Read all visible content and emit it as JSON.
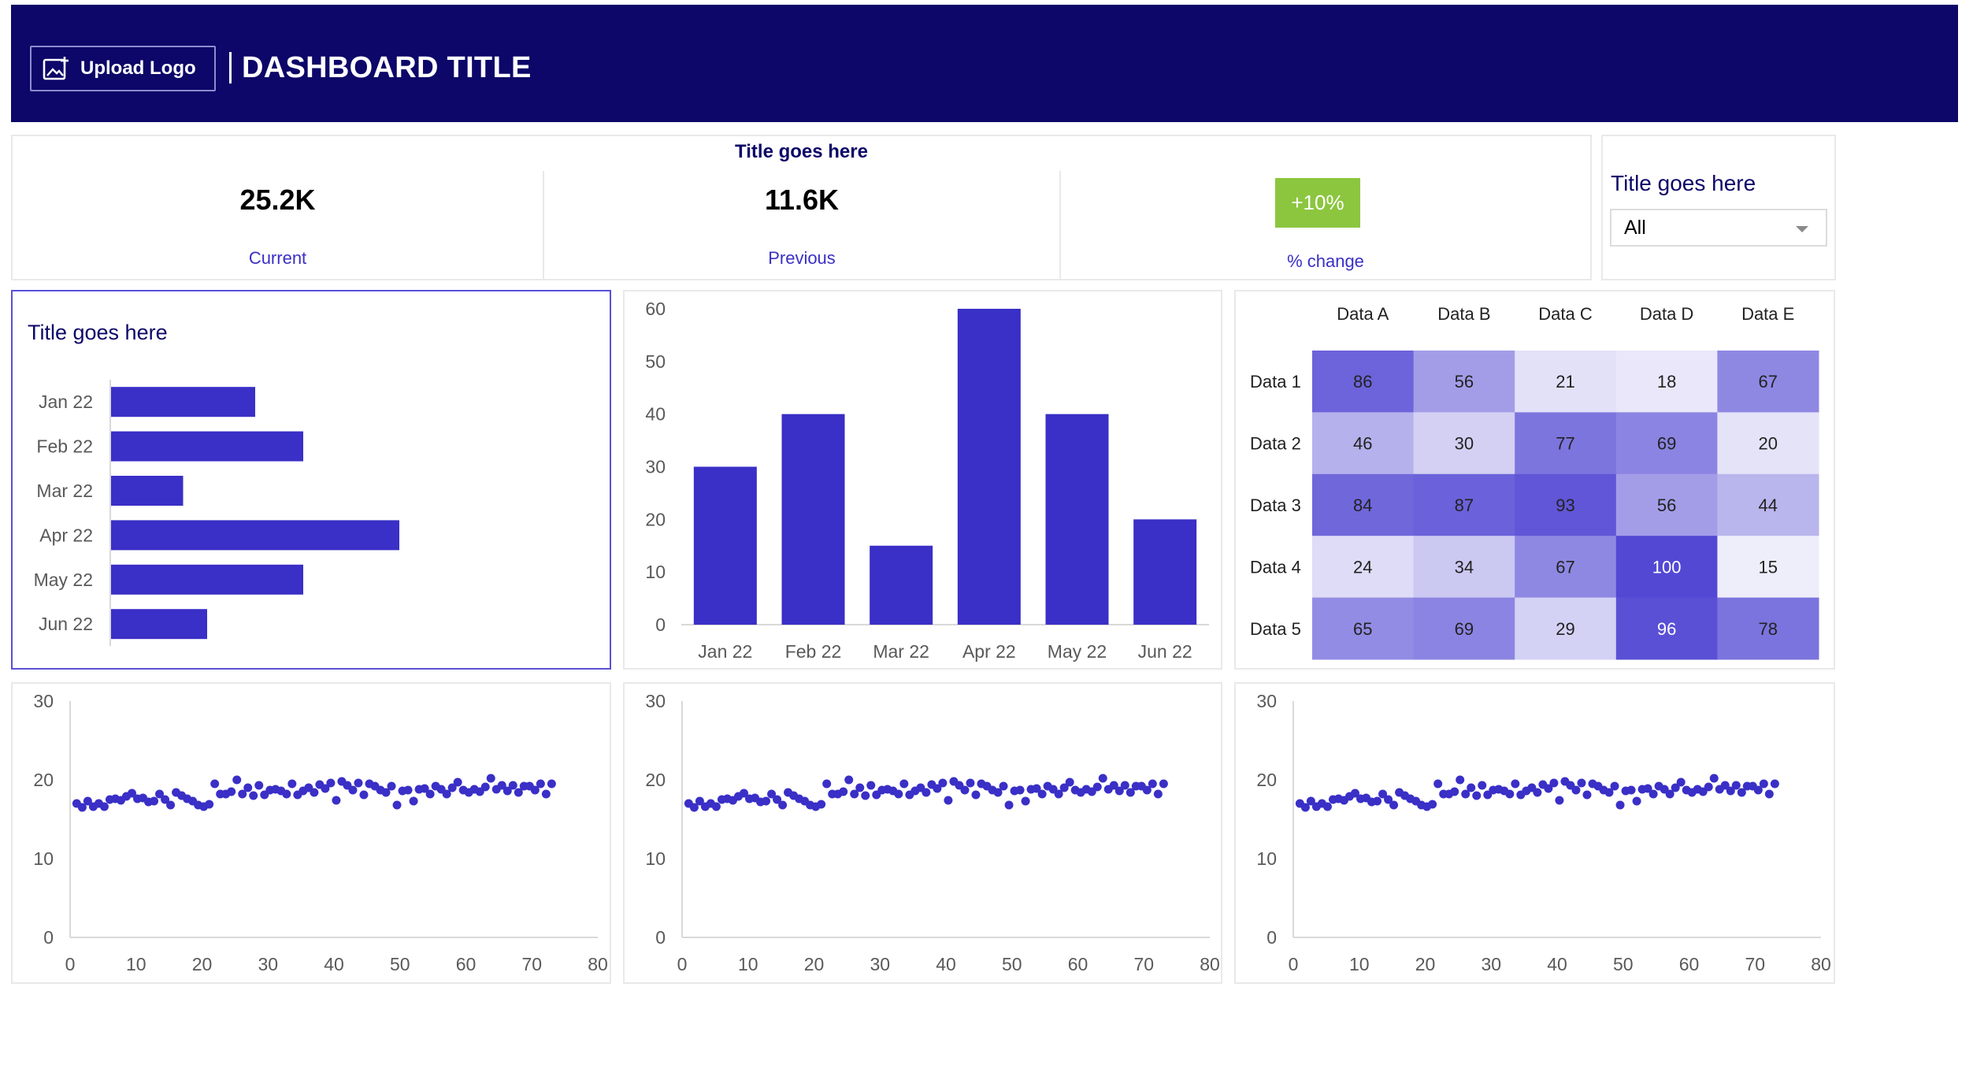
{
  "header": {
    "upload_label": "Upload Logo",
    "title": "DASHBOARD TITLE",
    "background": "#0c0768"
  },
  "kpi": {
    "title": "Title goes here",
    "current_value": "25.2K",
    "current_label": "Current",
    "previous_value": "11.6K",
    "previous_label": "Previous",
    "change_value": "+10%",
    "change_label": "% change",
    "change_color": "#8cc63f"
  },
  "filter": {
    "title": "Title goes here",
    "selected": "All"
  },
  "colors": {
    "accent": "#3a2fc6",
    "title_text": "#0c0768",
    "label_text": "#3a30c4"
  },
  "chart_data": [
    {
      "type": "bar",
      "orientation": "horizontal",
      "title": "Title goes here",
      "categories": [
        "Jan 22",
        "Feb 22",
        "Mar 22",
        "Apr 22",
        "May 22",
        "Jun 22"
      ],
      "values": [
        30,
        40,
        15,
        60,
        40,
        20
      ],
      "xlim": [
        0,
        100
      ],
      "grid": false
    },
    {
      "type": "bar",
      "orientation": "vertical",
      "categories": [
        "Jan 22",
        "Feb 22",
        "Mar 22",
        "Apr 22",
        "May 22",
        "Jun 22"
      ],
      "values": [
        30,
        40,
        15,
        60,
        40,
        20
      ],
      "ylim": [
        0,
        60
      ],
      "yticks": [
        0,
        10,
        20,
        30,
        40,
        50,
        60
      ],
      "grid": false
    },
    {
      "type": "heatmap",
      "columns": [
        "Data A",
        "Data B",
        "Data C",
        "Data D",
        "Data E"
      ],
      "rows": [
        "Data 1",
        "Data 2",
        "Data 3",
        "Data 4",
        "Data 5"
      ],
      "values": [
        [
          86,
          56,
          21,
          18,
          67
        ],
        [
          46,
          30,
          77,
          69,
          20
        ],
        [
          84,
          87,
          93,
          56,
          44
        ],
        [
          24,
          34,
          67,
          100,
          15
        ],
        [
          65,
          69,
          29,
          96,
          78
        ]
      ]
    },
    {
      "type": "scatter",
      "xlim": [
        0,
        80
      ],
      "ylim": [
        0,
        30
      ],
      "xticks": [
        0,
        10,
        20,
        30,
        40,
        50,
        60,
        70,
        80
      ],
      "yticks": [
        0,
        10,
        20,
        30
      ],
      "x_start": 1,
      "values": [
        17.0,
        16.5,
        17.3,
        16.6,
        17.0,
        16.6,
        17.5,
        17.6,
        17.4,
        17.9,
        18.3,
        17.6,
        17.7,
        17.2,
        17.3,
        18.2,
        17.5,
        16.8,
        18.4,
        18.0,
        17.6,
        17.3,
        16.8,
        16.6,
        16.9,
        19.5,
        18.2,
        18.2,
        18.5,
        20.0,
        18.2,
        19.0,
        18.0,
        19.3,
        18.1,
        18.7,
        18.8,
        18.6,
        18.2,
        19.5,
        18.1,
        18.6,
        19.0,
        18.4,
        19.4,
        18.9,
        19.6,
        17.4,
        19.8,
        19.3,
        18.7,
        19.6,
        18.1,
        19.5,
        19.2,
        18.7,
        18.4,
        19.2,
        16.8,
        18.6,
        18.7,
        17.3,
        18.8,
        18.9,
        18.2,
        19.2,
        18.8,
        18.2,
        19.0,
        19.7,
        18.7,
        18.4,
        18.8,
        18.5,
        19.1,
        20.2,
        18.8,
        19.3,
        18.6,
        19.3,
        18.4,
        19.2,
        19.2,
        18.7,
        19.5,
        18.2,
        19.5
      ]
    },
    {
      "type": "scatter",
      "xlim": [
        0,
        80
      ],
      "ylim": [
        0,
        30
      ],
      "xticks": [
        0,
        10,
        20,
        30,
        40,
        50,
        60,
        70,
        80
      ],
      "yticks": [
        0,
        10,
        20,
        30
      ],
      "x_start": 1,
      "values": [
        17.0,
        16.5,
        17.3,
        16.6,
        17.0,
        16.6,
        17.5,
        17.6,
        17.4,
        17.9,
        18.3,
        17.6,
        17.7,
        17.2,
        17.3,
        18.2,
        17.5,
        16.8,
        18.4,
        18.0,
        17.6,
        17.3,
        16.8,
        16.6,
        16.9,
        19.5,
        18.2,
        18.2,
        18.5,
        20.0,
        18.2,
        19.0,
        18.0,
        19.3,
        18.1,
        18.7,
        18.8,
        18.6,
        18.2,
        19.5,
        18.1,
        18.6,
        19.0,
        18.4,
        19.4,
        18.9,
        19.6,
        17.4,
        19.8,
        19.3,
        18.7,
        19.6,
        18.1,
        19.5,
        19.2,
        18.7,
        18.4,
        19.2,
        16.8,
        18.6,
        18.7,
        17.3,
        18.8,
        18.9,
        18.2,
        19.2,
        18.8,
        18.2,
        19.0,
        19.7,
        18.7,
        18.4,
        18.8,
        18.5,
        19.1,
        20.2,
        18.8,
        19.3,
        18.6,
        19.3,
        18.4,
        19.2,
        19.2,
        18.7,
        19.5,
        18.2,
        19.5
      ]
    },
    {
      "type": "scatter",
      "xlim": [
        0,
        80
      ],
      "ylim": [
        0,
        30
      ],
      "xticks": [
        0,
        10,
        20,
        30,
        40,
        50,
        60,
        70,
        80
      ],
      "yticks": [
        0,
        10,
        20,
        30
      ],
      "x_start": 1,
      "values": [
        17.0,
        16.5,
        17.3,
        16.6,
        17.0,
        16.6,
        17.5,
        17.6,
        17.4,
        17.9,
        18.3,
        17.6,
        17.7,
        17.2,
        17.3,
        18.2,
        17.5,
        16.8,
        18.4,
        18.0,
        17.6,
        17.3,
        16.8,
        16.6,
        16.9,
        19.5,
        18.2,
        18.2,
        18.5,
        20.0,
        18.2,
        19.0,
        18.0,
        19.3,
        18.1,
        18.7,
        18.8,
        18.6,
        18.2,
        19.5,
        18.1,
        18.6,
        19.0,
        18.4,
        19.4,
        18.9,
        19.6,
        17.4,
        19.8,
        19.3,
        18.7,
        19.6,
        18.1,
        19.5,
        19.2,
        18.7,
        18.4,
        19.2,
        16.8,
        18.6,
        18.7,
        17.3,
        18.8,
        18.9,
        18.2,
        19.2,
        18.8,
        18.2,
        19.0,
        19.7,
        18.7,
        18.4,
        18.8,
        18.5,
        19.1,
        20.2,
        18.8,
        19.3,
        18.6,
        19.3,
        18.4,
        19.2,
        19.2,
        18.7,
        19.5,
        18.2,
        19.5
      ]
    }
  ]
}
